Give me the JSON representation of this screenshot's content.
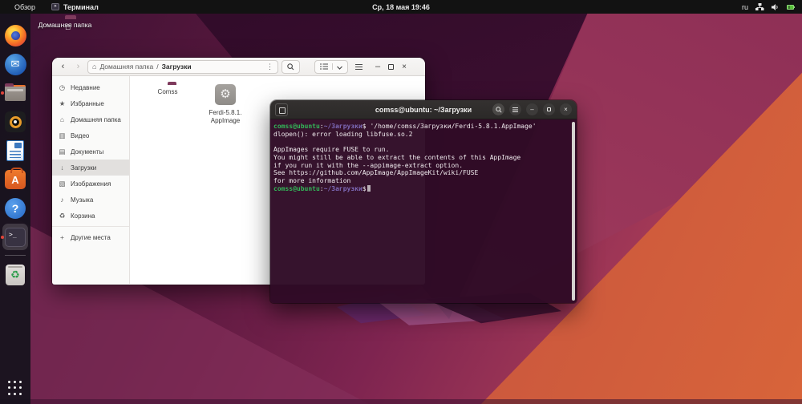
{
  "colors": {
    "term_green": "#33b558",
    "term_blue": "#7d6ab8",
    "terminal_bg": "#310b26",
    "running_dot": "#e0443a",
    "wallpaper_accent": "#a53a57"
  },
  "top_bar": {
    "activities": "Обзор",
    "app_name": "Терминал",
    "clock": "Ср, 18 мая 19:46",
    "keyboard_layout": "ru"
  },
  "glyphs": {
    "envelope": "✉",
    "question": "?",
    "software_letter": "A",
    "terminal_prompt": ">_",
    "recycle": "♻",
    "gear": "⚙",
    "home": "⌂",
    "kebab": "⋮",
    "slash": "/",
    "back": "‹",
    "forward": "›",
    "minimize": "–",
    "close": "×",
    "clock": "◷",
    "star": "★",
    "video": "▥",
    "docs": "▤",
    "down": "↓",
    "image": "▧",
    "music": "♪",
    "plus": "+"
  },
  "desktop": {
    "home_folder_label": "Домашняя папка"
  },
  "dock": {
    "items": [
      {
        "icon": "firefox-icon",
        "running": false
      },
      {
        "icon": "thunderbird-icon",
        "running": false
      },
      {
        "icon": "files-icon",
        "running": true
      },
      {
        "icon": "rhythmbox-icon",
        "running": false
      },
      {
        "icon": "libreoffice-writer-icon",
        "running": false
      },
      {
        "icon": "ubuntu-software-icon",
        "running": false
      },
      {
        "icon": "help-icon",
        "running": false
      },
      {
        "icon": "terminal-icon",
        "running": true,
        "active": true
      },
      {
        "icon": "trash-icon",
        "running": false
      },
      {
        "icon": "app-grid-icon",
        "running": false
      }
    ]
  },
  "files_window": {
    "breadcrumb_root": "Домашняя папка",
    "breadcrumb_sep": "/",
    "breadcrumb_current": "Загрузки",
    "sidebar": [
      {
        "label": "Недавние"
      },
      {
        "label": "Избранные"
      },
      {
        "label": "Домашняя папка"
      },
      {
        "label": "Видео"
      },
      {
        "label": "Документы"
      },
      {
        "label": "Загрузки",
        "selected": true
      },
      {
        "label": "Изображения"
      },
      {
        "label": "Музыка"
      },
      {
        "label": "Корзина"
      }
    ],
    "other_places": "Другие места",
    "files": [
      {
        "label": "Comss",
        "type": "folder"
      },
      {
        "label_line1": "Ferdi-5.8.1.",
        "label_line2": "AppImage",
        "type": "appimage"
      }
    ]
  },
  "terminal_window": {
    "title": "comss@ubuntu: ~/Загрузки",
    "prompt": {
      "user_host": "comss@ubuntu",
      "colon": ":",
      "path": "~/Загрузки",
      "dollar": "$"
    },
    "command_text": " '/home/comss/Загрузки/Ferdi-5.8.1.AppImage'",
    "output_lines": [
      "dlopen(): error loading libfuse.so.2",
      "",
      "AppImages require FUSE to run.",
      "You might still be able to extract the contents of this AppImage",
      "if you run it with the --appimage-extract option.",
      "See https://github.com/AppImage/AppImageKit/wiki/FUSE",
      "for more information"
    ]
  }
}
